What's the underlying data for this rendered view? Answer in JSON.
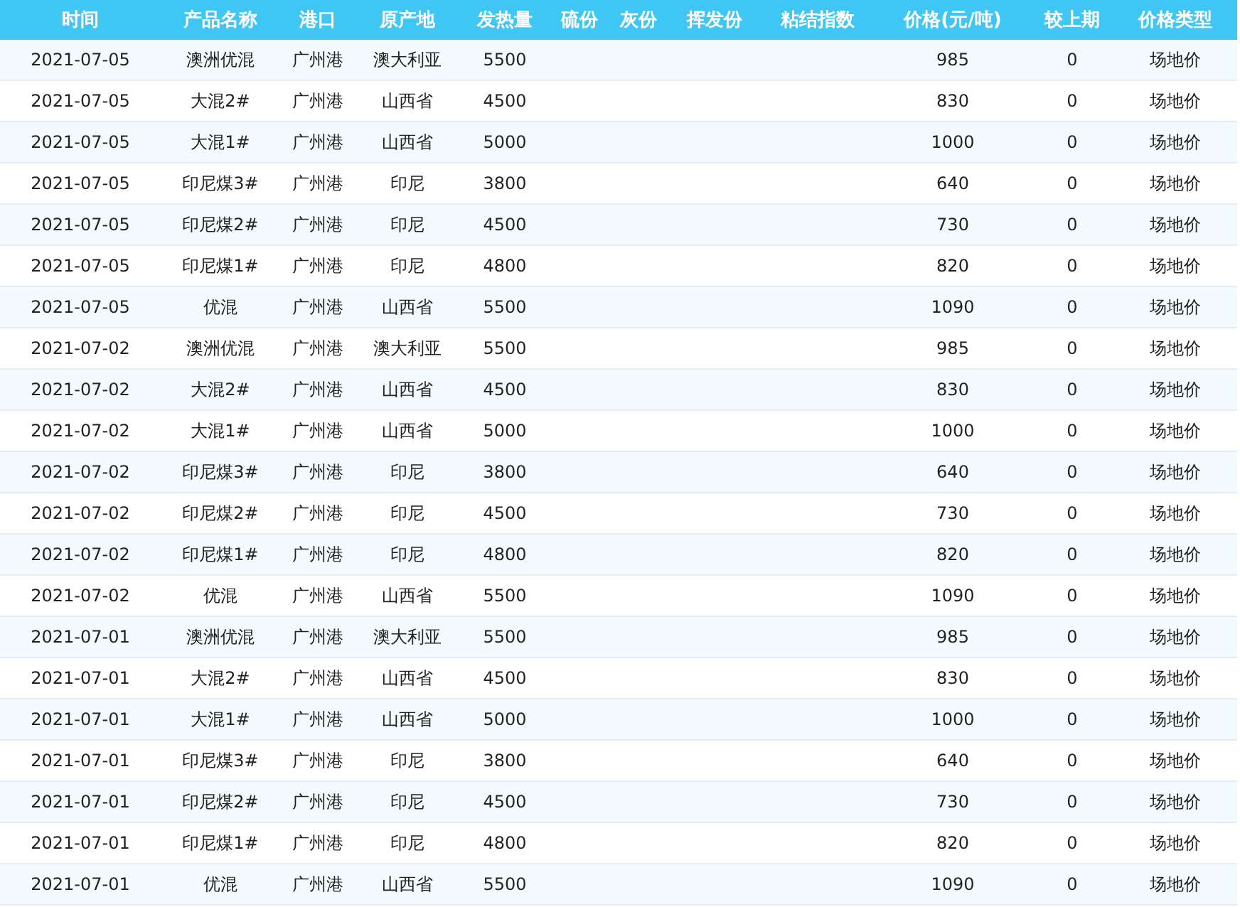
{
  "table": {
    "columns": [
      "时间",
      "产品名称",
      "港口",
      "原产地",
      "发热量",
      "硫份",
      "灰份",
      "挥发份",
      "粘结指数",
      "价格(元/吨)",
      "较上期",
      "价格类型"
    ],
    "rows": [
      {
        "date": "2021-07-05",
        "product": "澳洲优混",
        "port": "广州港",
        "origin": "澳大利亚",
        "calorific": "5500",
        "price": "985",
        "change": "0",
        "price_type": "场地价"
      },
      {
        "date": "2021-07-05",
        "product": "大混2#",
        "port": "广州港",
        "origin": "山西省",
        "calorific": "4500",
        "price": "830",
        "change": "0",
        "price_type": "场地价"
      },
      {
        "date": "2021-07-05",
        "product": "大混1#",
        "port": "广州港",
        "origin": "山西省",
        "calorific": "5000",
        "price": "1000",
        "change": "0",
        "price_type": "场地价"
      },
      {
        "date": "2021-07-05",
        "product": "印尼煤3#",
        "port": "广州港",
        "origin": "印尼",
        "calorific": "3800",
        "price": "640",
        "change": "0",
        "price_type": "场地价"
      },
      {
        "date": "2021-07-05",
        "product": "印尼煤2#",
        "port": "广州港",
        "origin": "印尼",
        "calorific": "4500",
        "price": "730",
        "change": "0",
        "price_type": "场地价"
      },
      {
        "date": "2021-07-05",
        "product": "印尼煤1#",
        "port": "广州港",
        "origin": "印尼",
        "calorific": "4800",
        "price": "820",
        "change": "0",
        "price_type": "场地价"
      },
      {
        "date": "2021-07-05",
        "product": "优混",
        "port": "广州港",
        "origin": "山西省",
        "calorific": "5500",
        "price": "1090",
        "change": "0",
        "price_type": "场地价"
      },
      {
        "date": "2021-07-02",
        "product": "澳洲优混",
        "port": "广州港",
        "origin": "澳大利亚",
        "calorific": "5500",
        "price": "985",
        "change": "0",
        "price_type": "场地价"
      },
      {
        "date": "2021-07-02",
        "product": "大混2#",
        "port": "广州港",
        "origin": "山西省",
        "calorific": "4500",
        "price": "830",
        "change": "0",
        "price_type": "场地价"
      },
      {
        "date": "2021-07-02",
        "product": "大混1#",
        "port": "广州港",
        "origin": "山西省",
        "calorific": "5000",
        "price": "1000",
        "change": "0",
        "price_type": "场地价"
      },
      {
        "date": "2021-07-02",
        "product": "印尼煤3#",
        "port": "广州港",
        "origin": "印尼",
        "calorific": "3800",
        "price": "640",
        "change": "0",
        "price_type": "场地价"
      },
      {
        "date": "2021-07-02",
        "product": "印尼煤2#",
        "port": "广州港",
        "origin": "印尼",
        "calorific": "4500",
        "price": "730",
        "change": "0",
        "price_type": "场地价"
      },
      {
        "date": "2021-07-02",
        "product": "印尼煤1#",
        "port": "广州港",
        "origin": "印尼",
        "calorific": "4800",
        "price": "820",
        "change": "0",
        "price_type": "场地价"
      },
      {
        "date": "2021-07-02",
        "product": "优混",
        "port": "广州港",
        "origin": "山西省",
        "calorific": "5500",
        "price": "1090",
        "change": "0",
        "price_type": "场地价"
      },
      {
        "date": "2021-07-01",
        "product": "澳洲优混",
        "port": "广州港",
        "origin": "澳大利亚",
        "calorific": "5500",
        "price": "985",
        "change": "0",
        "price_type": "场地价"
      },
      {
        "date": "2021-07-01",
        "product": "大混2#",
        "port": "广州港",
        "origin": "山西省",
        "calorific": "4500",
        "price": "830",
        "change": "0",
        "price_type": "场地价"
      },
      {
        "date": "2021-07-01",
        "product": "大混1#",
        "port": "广州港",
        "origin": "山西省",
        "calorific": "5000",
        "price": "1000",
        "change": "0",
        "price_type": "场地价"
      },
      {
        "date": "2021-07-01",
        "product": "印尼煤3#",
        "port": "广州港",
        "origin": "印尼",
        "calorific": "3800",
        "price": "640",
        "change": "0",
        "price_type": "场地价"
      },
      {
        "date": "2021-07-01",
        "product": "印尼煤2#",
        "port": "广州港",
        "origin": "印尼",
        "calorific": "4500",
        "price": "730",
        "change": "0",
        "price_type": "场地价"
      },
      {
        "date": "2021-07-01",
        "product": "印尼煤1#",
        "port": "广州港",
        "origin": "印尼",
        "calorific": "4800",
        "price": "820",
        "change": "0",
        "price_type": "场地价"
      },
      {
        "date": "2021-07-01",
        "product": "优混",
        "port": "广州港",
        "origin": "山西省",
        "calorific": "5500",
        "price": "1090",
        "change": "0",
        "price_type": "场地价"
      }
    ]
  }
}
